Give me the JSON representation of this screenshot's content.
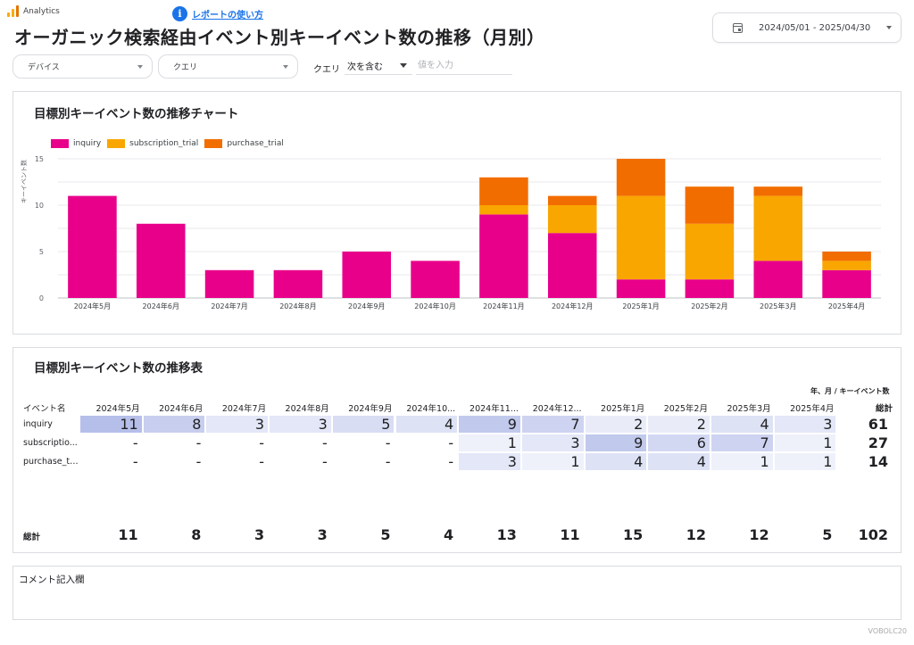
{
  "header": {
    "brand": "Analytics",
    "help_link": "レポートの使い方",
    "title": "オーガニック検索経由イベント別キーイベント数の推移（月別）",
    "date_range": "2024/05/01 - 2025/04/30"
  },
  "filters": {
    "device": "デバイス",
    "query": "クエリ",
    "query_label": "クエリ",
    "query_operator": "次を含む",
    "query_value_placeholder": "値を入力"
  },
  "chart_panel": {
    "title": "目標別キーイベント数の推移チャート"
  },
  "chart_data": {
    "type": "bar",
    "stacked": true,
    "categories": [
      "2024年5月",
      "2024年6月",
      "2024年7月",
      "2024年8月",
      "2024年9月",
      "2024年10月",
      "2024年11月",
      "2024年12月",
      "2025年1月",
      "2025年2月",
      "2025年3月",
      "2025年4月"
    ],
    "series": [
      {
        "name": "inquiry",
        "color": "#e8008a",
        "values": [
          11,
          8,
          3,
          3,
          5,
          4,
          9,
          7,
          2,
          2,
          4,
          3
        ]
      },
      {
        "name": "subscription_trial",
        "color": "#f9a600",
        "values": [
          0,
          0,
          0,
          0,
          0,
          0,
          1,
          3,
          9,
          6,
          7,
          1
        ]
      },
      {
        "name": "purchase_trial",
        "color": "#f26d00",
        "values": [
          0,
          0,
          0,
          0,
          0,
          0,
          3,
          1,
          4,
          4,
          1,
          1
        ]
      }
    ],
    "ylabel": "キーイベント数",
    "ylim": [
      0,
      15
    ],
    "yticks": [
      "0",
      "5",
      "10",
      "15"
    ],
    "grid": true,
    "legend": "top-left"
  },
  "table_panel": {
    "title": "目標別キーイベント数の推移表",
    "caption": "年、月 / キーイベント数",
    "row_header": "イベント名",
    "total_col_label": "総計",
    "total_row_label": "総計",
    "columns": [
      "2024年5月",
      "2024年6月",
      "2024年7月",
      "2024年8月",
      "2024年9月",
      "2024年10...",
      "2024年11...",
      "2024年12...",
      "2025年1月",
      "2025年2月",
      "2025年3月",
      "2025年4月"
    ],
    "rows": [
      {
        "label": "inquiry",
        "cells": [
          "11",
          "8",
          "3",
          "3",
          "5",
          "4",
          "9",
          "7",
          "2",
          "2",
          "4",
          "3"
        ],
        "total": "61"
      },
      {
        "label": "subscriptio...",
        "cells": [
          "-",
          "-",
          "-",
          "-",
          "-",
          "-",
          "1",
          "3",
          "9",
          "6",
          "7",
          "1"
        ],
        "total": "27"
      },
      {
        "label": "purchase_tr...",
        "cells": [
          "-",
          "-",
          "-",
          "-",
          "-",
          "-",
          "3",
          "1",
          "4",
          "4",
          "1",
          "1"
        ],
        "total": "14"
      }
    ],
    "totals": [
      "11",
      "8",
      "3",
      "3",
      "5",
      "4",
      "13",
      "11",
      "15",
      "12",
      "12",
      "5"
    ],
    "grand_total": "102"
  },
  "comment_panel": {
    "label": "コメント記入欄"
  },
  "footer": {
    "watermark": "VOBOLC20"
  }
}
